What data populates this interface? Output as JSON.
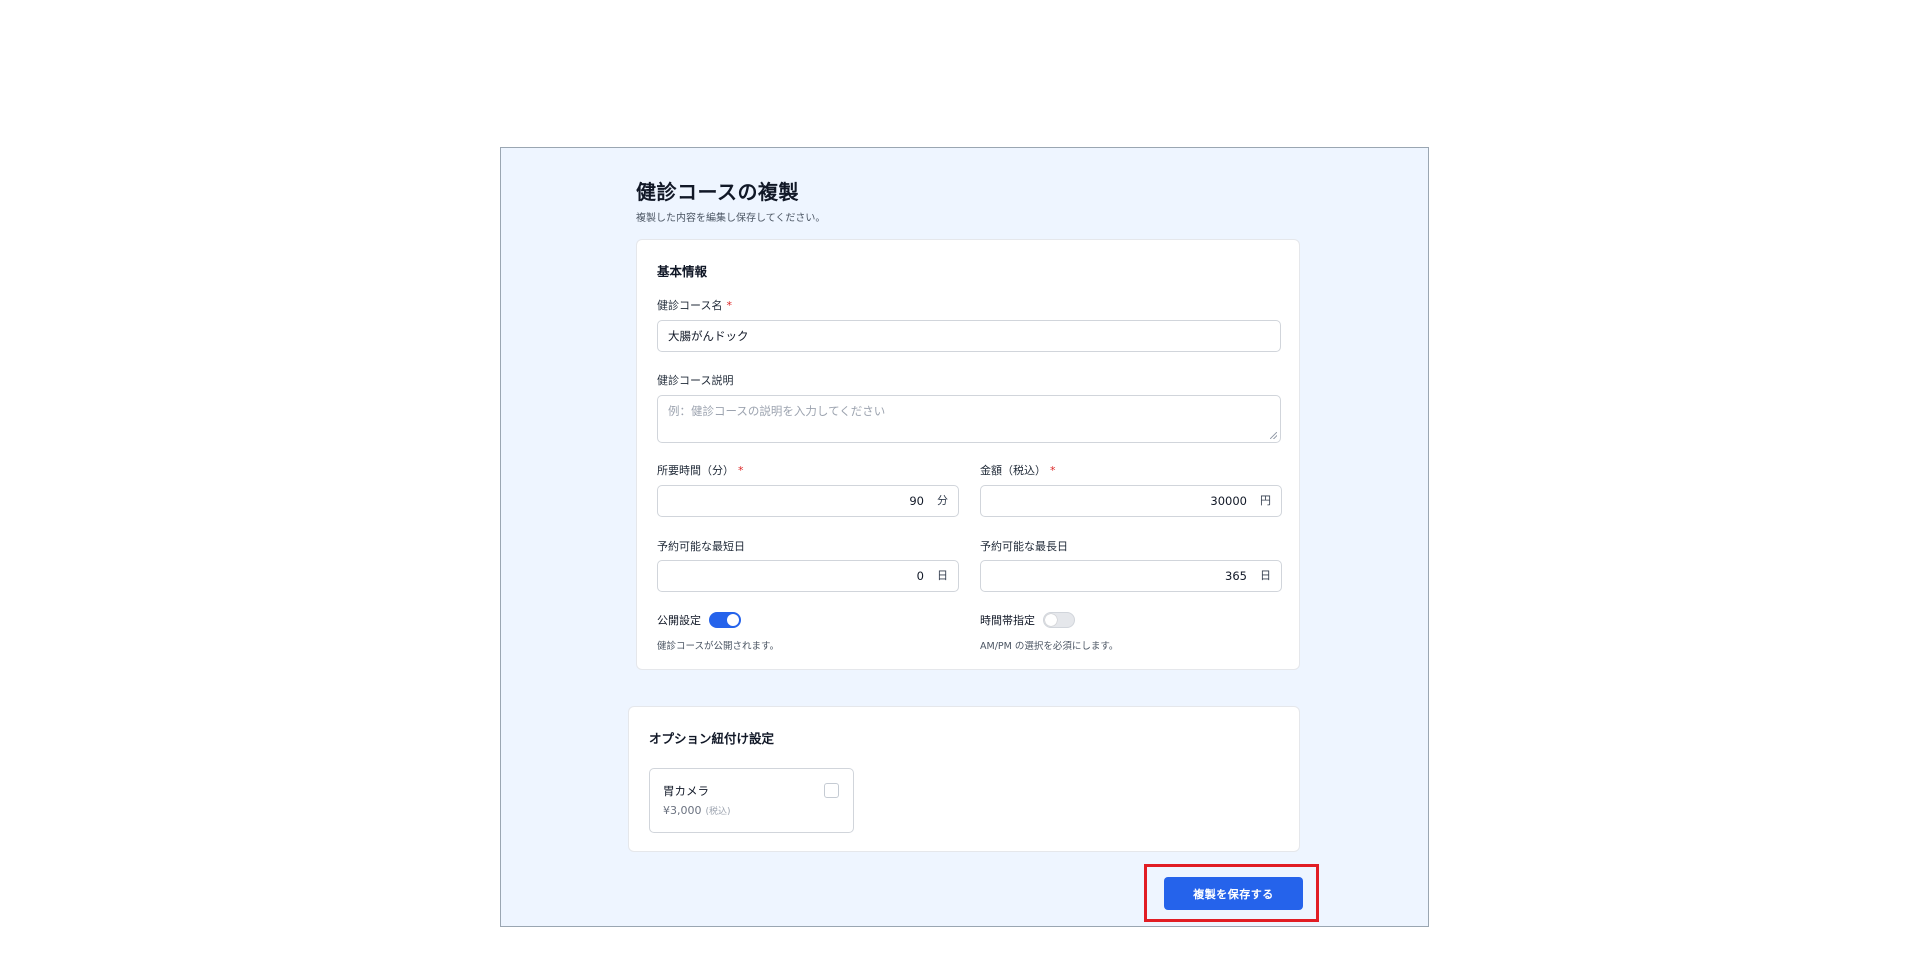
{
  "page": {
    "title": "健診コースの複製",
    "subtitle": "複製した内容を編集し保存してください。"
  },
  "basic": {
    "section_title": "基本情報",
    "course_name": {
      "label": "健診コース名",
      "required_mark": "*",
      "value": "大腸がんドック"
    },
    "description": {
      "label": "健診コース説明",
      "placeholder": "例：健診コースの説明を入力してください"
    },
    "duration": {
      "label": "所要時間（分）",
      "required_mark": "*",
      "value": "90",
      "unit": "分"
    },
    "price": {
      "label": "金額（税込）",
      "required_mark": "*",
      "value": "30000",
      "unit": "円"
    },
    "min_days": {
      "label": "予約可能な最短日",
      "value": "0",
      "unit": "日"
    },
    "max_days": {
      "label": "予約可能な最長日",
      "value": "365",
      "unit": "日"
    },
    "publish": {
      "label": "公開設定",
      "on": true,
      "help": "健診コースが公開されます。"
    },
    "time_slot": {
      "label": "時間帯指定",
      "on": false,
      "help": "AM/PM の選択を必須にします。"
    }
  },
  "options": {
    "section_title": "オプション紐付け設定",
    "items": [
      {
        "name": "胃カメラ",
        "price": "¥3,000",
        "tax_note": "(税込)",
        "checked": false
      }
    ]
  },
  "actions": {
    "save_label": "複製を保存する"
  },
  "colors": {
    "accent": "#2563eb",
    "highlight": "#e11d24",
    "background": "#eef5ff",
    "required": "#dc2626"
  }
}
